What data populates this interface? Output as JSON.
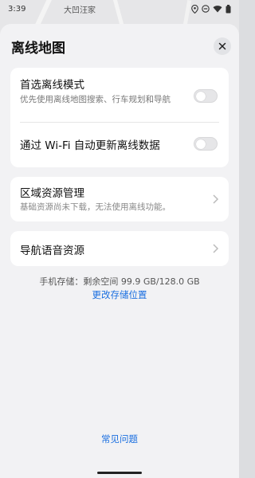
{
  "status_bar": {
    "time": "3:39",
    "location": "大凹汪家",
    "icons": [
      "location-icon",
      "minus-circle-icon",
      "wifi-icon",
      "battery-icon"
    ]
  },
  "sheet": {
    "title": "离线地图",
    "close_icon": "close-icon"
  },
  "offline_settings": {
    "prefer_offline": {
      "title": "首选离线模式",
      "subtitle": "优先使用离线地图搜索、行车规划和导航",
      "enabled": false
    },
    "wifi_auto_update": {
      "title": "通过 Wi-Fi 自动更新离线数据",
      "enabled": false
    }
  },
  "region_resources": {
    "title": "区域资源管理",
    "subtitle": "基础资源尚未下载，无法使用离线功能。"
  },
  "nav_voice": {
    "title": "导航语音资源"
  },
  "storage": {
    "text": "手机存储：剩余空间 99.9 GB/128.0 GB",
    "change_location": "更改存储位置"
  },
  "faq": {
    "label": "常见问题"
  },
  "colors": {
    "accent": "#1a6fe0",
    "card_bg": "#ffffff",
    "sheet_bg": "#f2f2f4"
  }
}
